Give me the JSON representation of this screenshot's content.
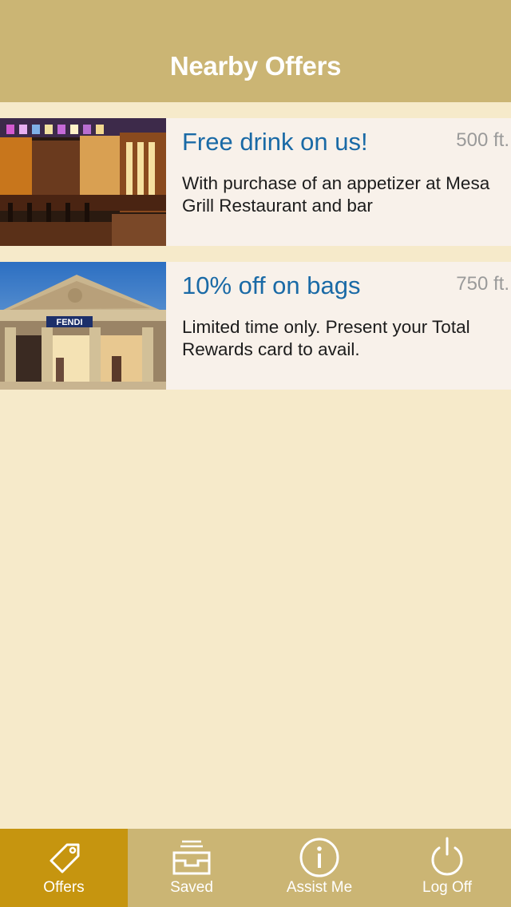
{
  "header": {
    "title": "Nearby Offers"
  },
  "offers": [
    {
      "title": "Free drink on us!",
      "distance": "500 ft.",
      "description": "With purchase of an appetizer at Mesa Grill Restaurant and bar",
      "image": "restaurant-bar-photo"
    },
    {
      "title": "10% off on bags",
      "distance": "750 ft.",
      "description": "Limited time only. Present your Total Rewards card to avail.",
      "image": "fendi-storefront-photo",
      "sign_text": "FENDI"
    }
  ],
  "tabbar": {
    "tabs": [
      {
        "label": "Offers",
        "icon": "tag-icon",
        "active": true
      },
      {
        "label": "Saved",
        "icon": "inbox-tray-icon",
        "active": false
      },
      {
        "label": "Assist Me",
        "icon": "info-icon",
        "active": false
      },
      {
        "label": "Log Off",
        "icon": "power-icon",
        "active": false
      }
    ]
  },
  "colors": {
    "background": "#f6eaca",
    "header": "#cbb574",
    "active_tab": "#c6950f",
    "offer_title": "#1a6aa6",
    "card": "#f8f1ea"
  }
}
